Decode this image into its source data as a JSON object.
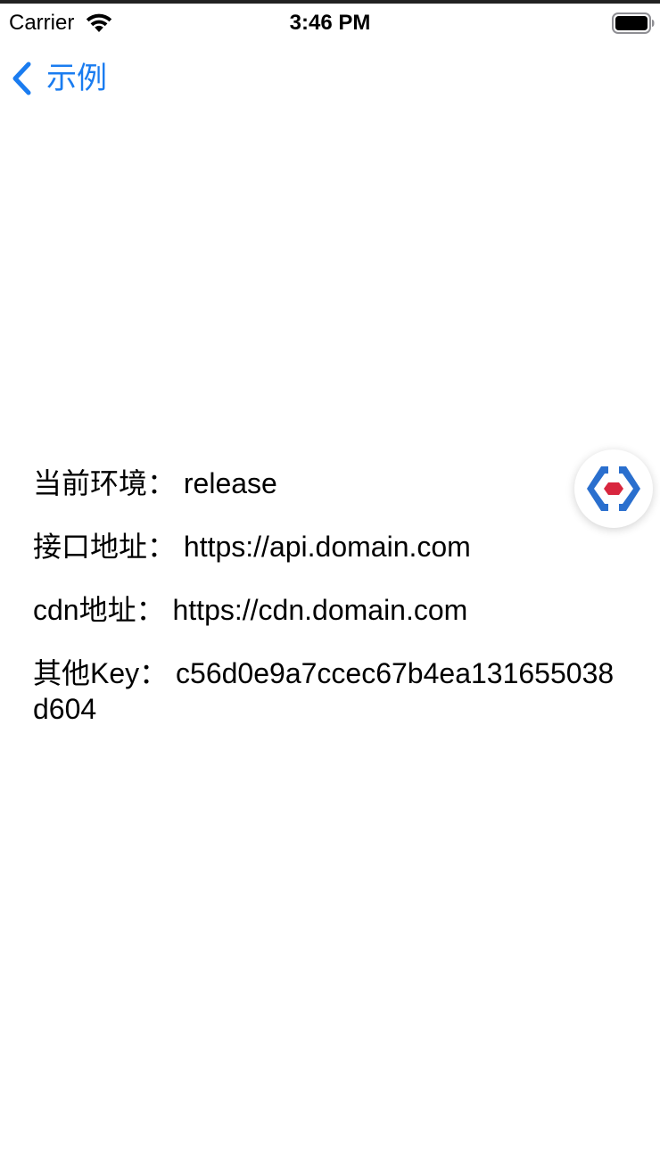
{
  "status_bar": {
    "carrier": "Carrier",
    "time": "3:46 PM"
  },
  "nav": {
    "back_label": "示例"
  },
  "info": {
    "env": "当前环境：  release",
    "api": "接口地址：  https://api.domain.com",
    "cdn": "cdn地址：  https://cdn.domain.com",
    "key": "其他Key：  c56d0e9a7ccec67b4ea131655038d604"
  },
  "colors": {
    "accent": "#1a7cf0",
    "logo_blue": "#2a6fce",
    "logo_red": "#d8263e"
  },
  "icons": {
    "wifi": "wifi-icon",
    "battery": "battery-icon",
    "back": "chevron-left-icon",
    "float": "debug-tool-icon"
  }
}
